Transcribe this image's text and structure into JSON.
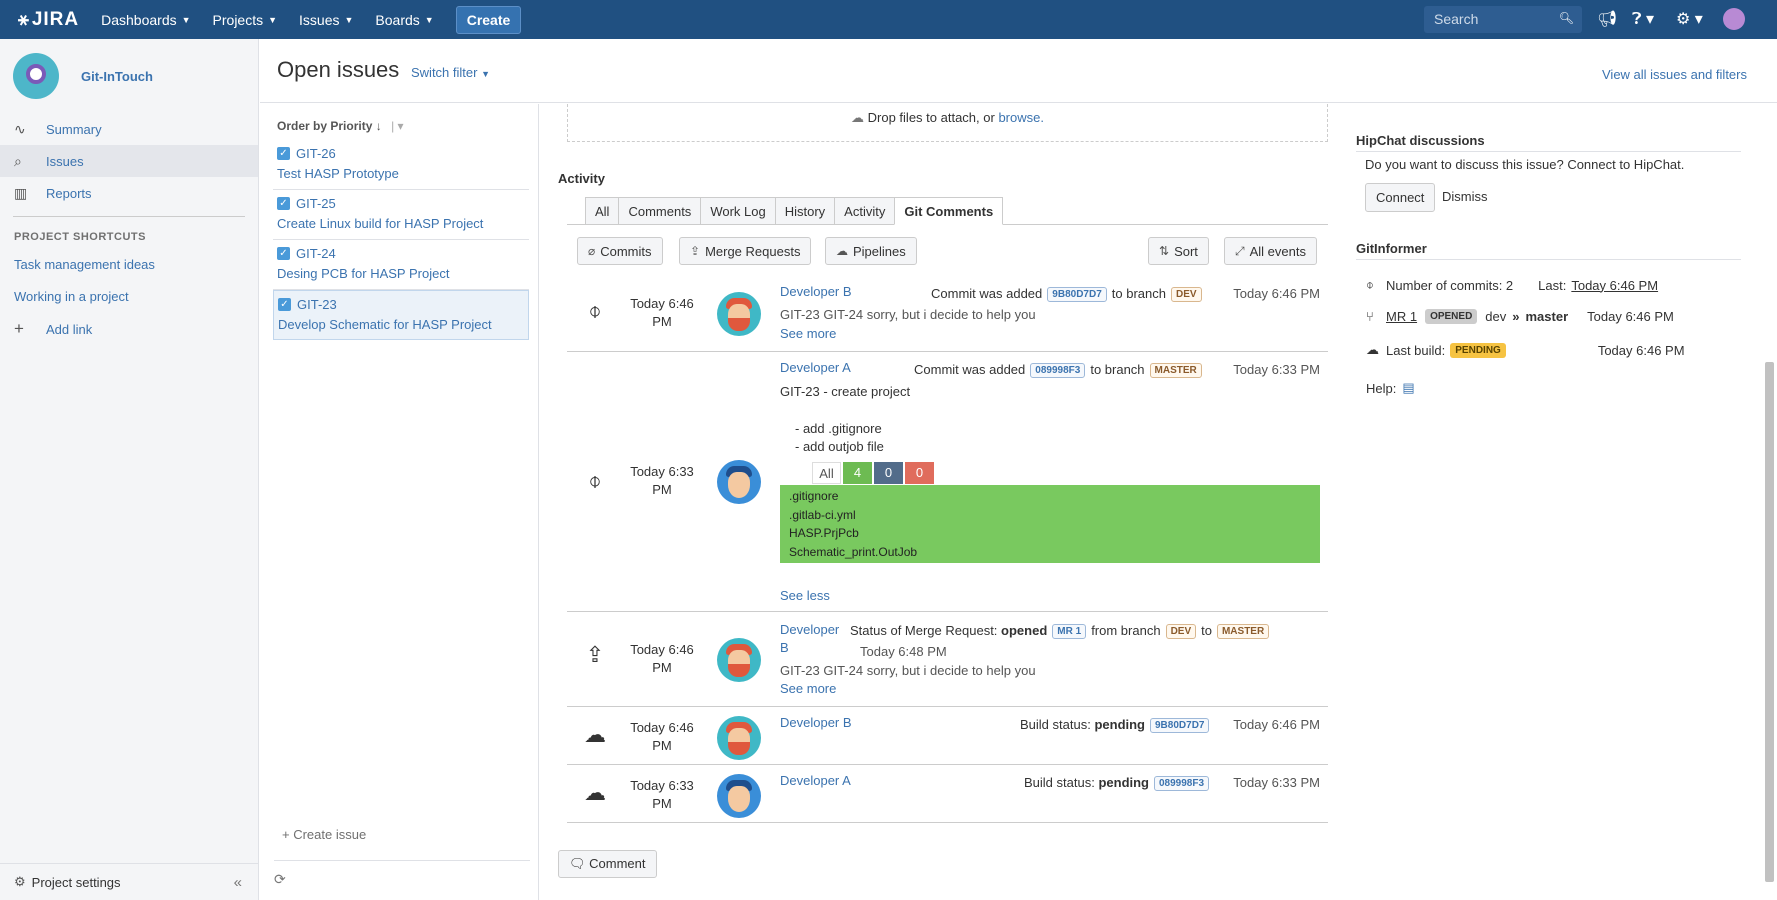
{
  "topbar": {
    "logo": "JIRA",
    "nav": [
      {
        "label": "Dashboards"
      },
      {
        "label": "Projects"
      },
      {
        "label": "Issues"
      },
      {
        "label": "Boards"
      }
    ],
    "create_label": "Create",
    "search_placeholder": "Search"
  },
  "sidebar": {
    "project_name": "Git-InTouch",
    "items": [
      {
        "label": "Summary"
      },
      {
        "label": "Issues"
      },
      {
        "label": "Reports"
      }
    ],
    "shortcuts_header": "PROJECT SHORTCUTS",
    "shortcuts": [
      "Task management ideas",
      "Working in a project"
    ],
    "add_link_label": "Add link",
    "settings_label": "Project settings"
  },
  "header": {
    "title": "Open issues",
    "switch_filter": "Switch filter",
    "view_all": "View all issues and filters"
  },
  "issue_list": {
    "order_by": "Order by Priority",
    "issues": [
      {
        "key": "GIT-26",
        "summary": "Test HASP Prototype"
      },
      {
        "key": "GIT-25",
        "summary": "Create Linux build for HASP Project"
      },
      {
        "key": "GIT-24",
        "summary": "Desing PCB for HASP Project"
      },
      {
        "key": "GIT-23",
        "summary": "Develop Schematic for HASP Project"
      }
    ],
    "create_issue": "+ Create issue"
  },
  "detail": {
    "drop_text": "Drop files to attach, or",
    "browse": "browse.",
    "activity_header": "Activity",
    "tabs": [
      "All",
      "Comments",
      "Work Log",
      "History",
      "Activity",
      "Git Comments"
    ],
    "buttons": {
      "commits": "Commits",
      "merge_requests": "Merge Requests",
      "pipelines": "Pipelines",
      "sort": "Sort",
      "all_events": "All events"
    },
    "events": [
      {
        "time_line1": "Today 6:46",
        "time_line2": "PM",
        "author": "Developer B",
        "action": "Commit was added",
        "hash": "9B80D7D7",
        "to_branch": "to branch",
        "branch": "DEV",
        "timestamp": "Today 6:46 PM",
        "message": "GIT-23 GIT-24 sorry, but i decide to help you",
        "see": "See more"
      },
      {
        "time_line1": "Today 6:33",
        "time_line2": "PM",
        "author": "Developer A",
        "action": "Commit was added",
        "hash": "089998F3",
        "to_branch": "to branch",
        "branch": "MASTER",
        "timestamp": "Today 6:33 PM",
        "message": "GIT-23 - create project",
        "bullet1": "- add .gitignore",
        "bullet2": "- add outjob file",
        "diff": {
          "all": "All",
          "added": "4",
          "modified": "0",
          "deleted": "0"
        },
        "files": [
          ".gitignore",
          ".gitlab-ci.yml",
          "HASP.PrjPcb",
          "Schematic_print.OutJob"
        ],
        "see": "See less"
      },
      {
        "time_line1": "Today 6:46",
        "time_line2": "PM",
        "author_line1": "Developer",
        "author_line2": "B",
        "status_label": "Status of Merge Request:",
        "status": "opened",
        "mr": "MR 1",
        "from_branch_label": "from branch",
        "from_branch": "DEV",
        "to_label": "to",
        "to_branch": "MASTER",
        "timestamp": "Today 6:48 PM",
        "message": "GIT-23 GIT-24 sorry, but i decide to help you",
        "see": "See more"
      },
      {
        "time_line1": "Today 6:46",
        "time_line2": "PM",
        "author": "Developer B",
        "build_label": "Build status:",
        "status": "pending",
        "hash": "9B80D7D7",
        "timestamp": "Today 6:46 PM"
      },
      {
        "time_line1": "Today 6:33",
        "time_line2": "PM",
        "author": "Developer A",
        "build_label": "Build status:",
        "status": "pending",
        "hash": "089998F3",
        "timestamp": "Today 6:33 PM"
      }
    ],
    "comment_button": "Comment"
  },
  "right_panel": {
    "hipchat_header": "HipChat discussions",
    "hipchat_text": "Do you want to discuss this issue? Connect to HipChat.",
    "connect": "Connect",
    "dismiss": "Dismiss",
    "informer_header": "GitInformer",
    "commits_label": "Number of commits: 2",
    "last_label": "Last:",
    "last_value": "Today 6:46 PM",
    "mr_label": "MR 1",
    "mr_status": "OPENED",
    "mr_from": "dev",
    "mr_arrow": "»",
    "mr_to": "master",
    "mr_time": "Today 6:46 PM",
    "build_label": "Last build:",
    "build_status": "PENDING",
    "build_time": "Today 6:46 PM",
    "help_label": "Help:"
  }
}
